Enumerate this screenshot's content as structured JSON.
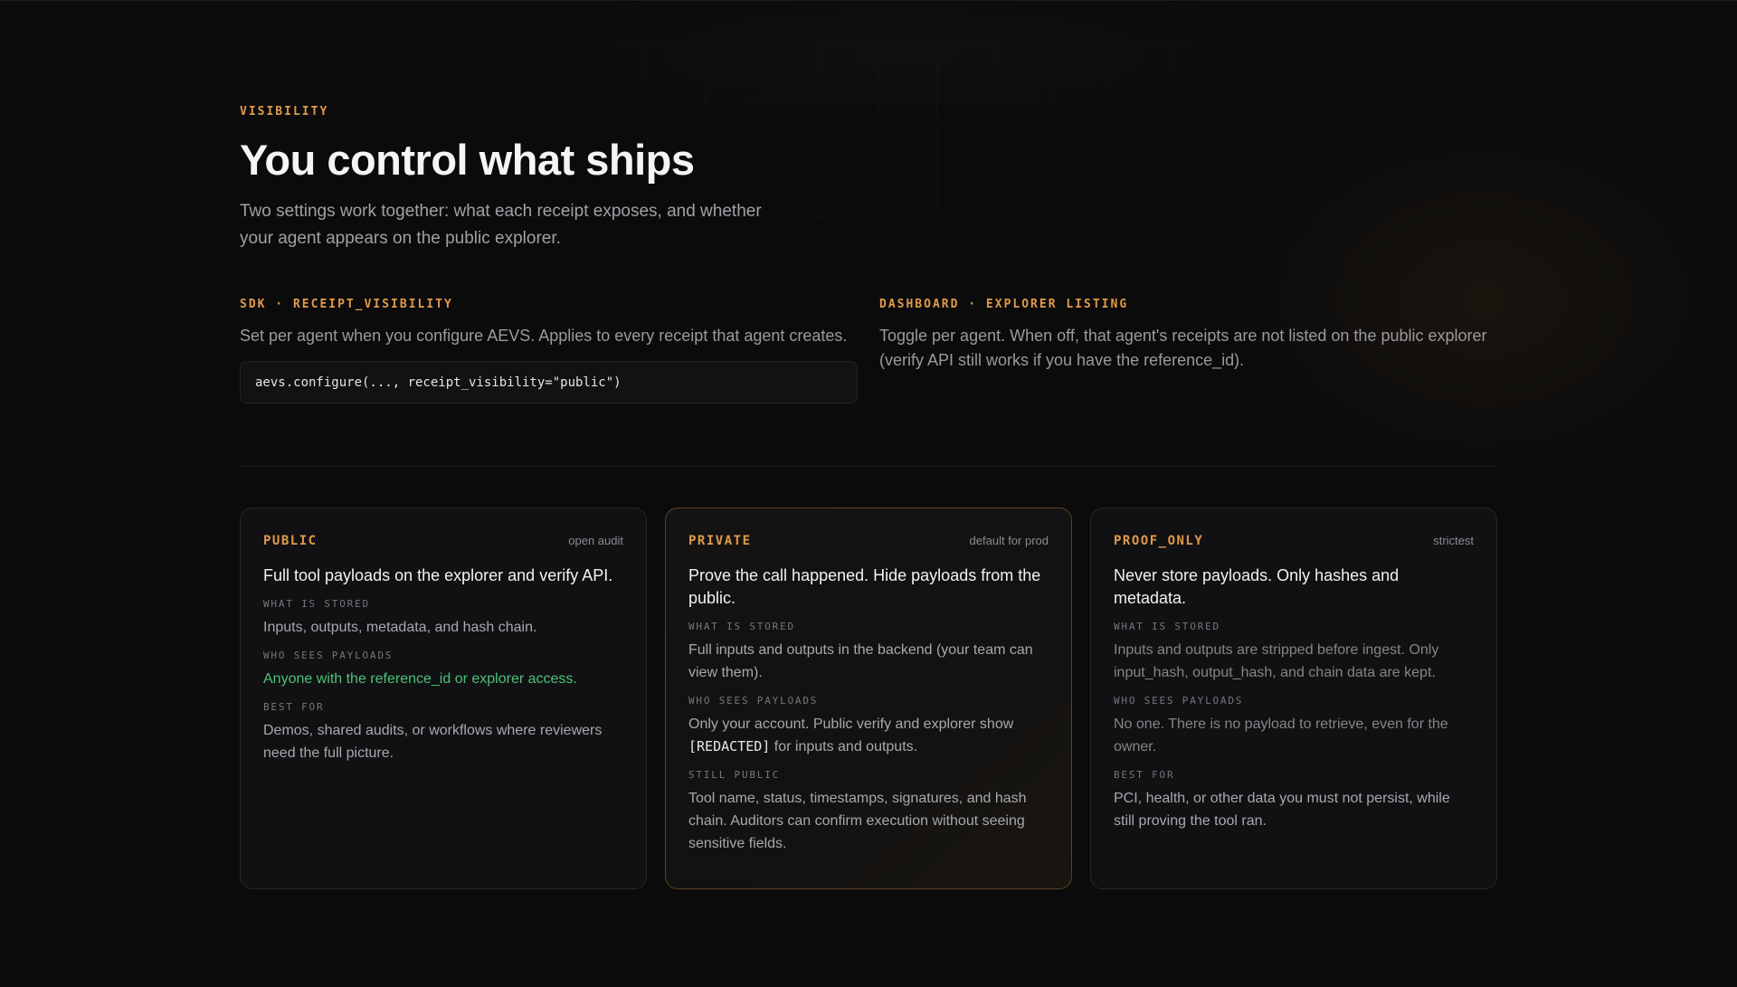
{
  "hero": {
    "eyebrow": "VISIBILITY",
    "title": "You control what ships",
    "subtitle": "Two settings work together: what each receipt exposes, and whether your agent appears on the public explorer."
  },
  "settings": {
    "sdk": {
      "label": "SDK · RECEIPT_VISIBILITY",
      "description": "Set per agent when you configure AEVS. Applies to every receipt that agent creates.",
      "code": "aevs.configure(..., receipt_visibility=\"public\")"
    },
    "dashboard": {
      "label": "DASHBOARD · EXPLORER LISTING",
      "description": "Toggle per agent. When off, that agent's receipts are not listed on the public explorer (verify API still works if you have the reference_id)."
    }
  },
  "cards": {
    "public": {
      "tag": "PUBLIC",
      "note": "open audit",
      "title": "Full tool payloads on the explorer and verify API.",
      "stored_label": "WHAT IS STORED",
      "stored": "Inputs, outputs, metadata, and hash chain.",
      "sees_label": "WHO SEES PAYLOADS",
      "sees": "Anyone with the reference_id or explorer access.",
      "best_label": "BEST FOR",
      "best": "Demos, shared audits, or workflows where reviewers need the full picture."
    },
    "private": {
      "tag": "PRIVATE",
      "note": "default for prod",
      "title": "Prove the call happened. Hide payloads from the public.",
      "stored_label": "WHAT IS STORED",
      "stored": "Full inputs and outputs in the backend (your team can view them).",
      "sees_label": "WHO SEES PAYLOADS",
      "sees_pre": "Only your account. Public verify and explorer show",
      "sees_code": "[REDACTED]",
      "sees_post": "for inputs and outputs.",
      "public_label": "STILL PUBLIC",
      "public": "Tool name, status, timestamps, signatures, and hash chain. Auditors can confirm execution without seeing sensitive fields."
    },
    "proof_only": {
      "tag": "PROOF_ONLY",
      "note": "strictest",
      "title": "Never store payloads. Only hashes and metadata.",
      "stored_label": "WHAT IS STORED",
      "stored": "Inputs and outputs are stripped before ingest. Only input_hash, output_hash, and chain data are kept.",
      "sees_label": "WHO SEES PAYLOADS",
      "sees": "No one. There is no payload to retrieve, even for the owner.",
      "best_label": "BEST FOR",
      "best": "PCI, health, or other data you must not persist, while still proving the tool ran."
    }
  },
  "colors": {
    "accent": "#e09a4a",
    "green": "#4ec27a",
    "background": "#0b0b0c"
  }
}
